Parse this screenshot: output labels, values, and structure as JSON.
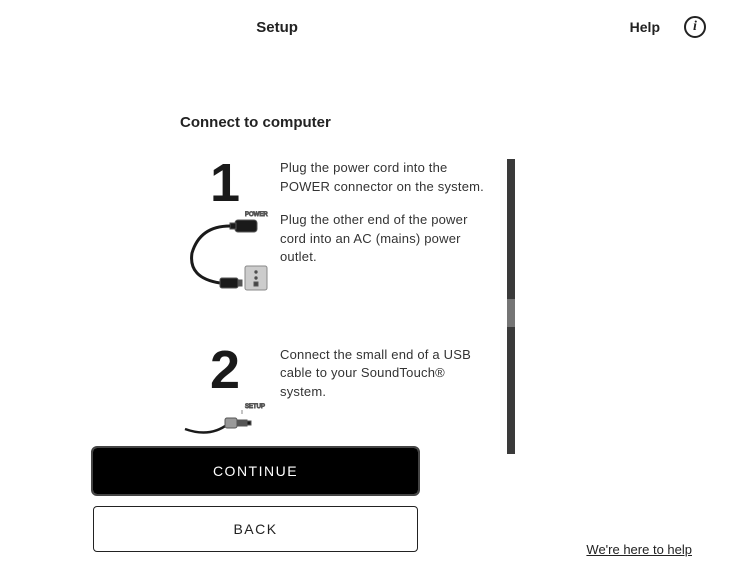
{
  "header": {
    "title": "Setup",
    "help": "Help",
    "info_glyph": "i"
  },
  "section": {
    "title": "Connect to computer"
  },
  "steps": [
    {
      "number": "1",
      "text_a": "Plug the power cord into the POWER connector on the system.",
      "text_b": "Plug the other end of the power cord into an AC (mains) power outlet."
    },
    {
      "number": "2",
      "text_a": "Connect the small end of a USB cable to your SoundTouch® system."
    }
  ],
  "labels": {
    "power": "POWER",
    "setup": "SETUP"
  },
  "buttons": {
    "continue": "CONTINUE",
    "back": "BACK"
  },
  "footer": {
    "help_link": "We're here to help"
  }
}
